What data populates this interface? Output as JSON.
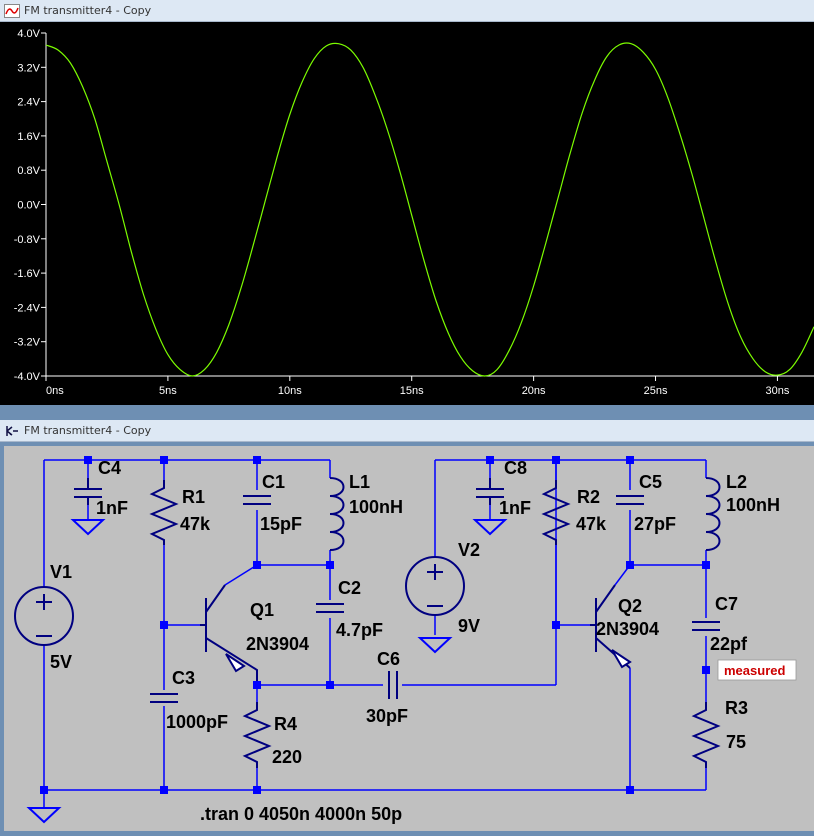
{
  "wave_window": {
    "title": "FM transmitter4 - Copy"
  },
  "schematic_window": {
    "title": "FM transmitter4 - Copy"
  },
  "chart_data": {
    "type": "line",
    "title": "",
    "xlabel": "",
    "ylabel": "",
    "x_ticks": [
      "0ns",
      "5ns",
      "10ns",
      "15ns",
      "20ns",
      "25ns",
      "30ns"
    ],
    "y_ticks": [
      "4.0V",
      "3.2V",
      "2.4V",
      "1.6V",
      "0.8V",
      "0.0V",
      "-0.8V",
      "-1.6V",
      "-2.4V",
      "-3.2V",
      "-4.0V"
    ],
    "xlim": [
      0,
      31.5
    ],
    "ylim": [
      -4.0,
      4.0
    ],
    "series": [
      {
        "color": "#7cfc00",
        "x": [
          0,
          0.5,
          1,
          1.5,
          2,
          2.5,
          3,
          3.5,
          4,
          4.5,
          5,
          5.5,
          6,
          6.5,
          7,
          7.5,
          8,
          8.5,
          9,
          9.5,
          10,
          10.5,
          11,
          11.5,
          12,
          12.5,
          13,
          13.5,
          14,
          14.5,
          15,
          15.5,
          16,
          16.5,
          17,
          17.5,
          18,
          18.5,
          19,
          19.5,
          20,
          20.5,
          21,
          21.5,
          22,
          22.5,
          23,
          23.5,
          24,
          24.5,
          25,
          25.5,
          26,
          26.5,
          27,
          27.5,
          28,
          28.5,
          29,
          29.5,
          30,
          30.5,
          31,
          31.5
        ],
        "y": [
          3.72,
          3.6,
          3.3,
          2.75,
          2.0,
          1.0,
          0.0,
          -1.1,
          -2.1,
          -2.9,
          -3.5,
          -3.85,
          -4.0,
          -3.85,
          -3.45,
          -2.8,
          -1.95,
          -0.95,
          0.1,
          1.15,
          2.1,
          2.85,
          3.4,
          3.7,
          3.75,
          3.6,
          3.2,
          2.55,
          1.75,
          0.8,
          -0.25,
          -1.3,
          -2.25,
          -3.0,
          -3.55,
          -3.88,
          -4.0,
          -3.85,
          -3.4,
          -2.75,
          -1.9,
          -0.9,
          0.15,
          1.2,
          2.15,
          2.9,
          3.45,
          3.72,
          3.75,
          3.55,
          3.15,
          2.5,
          1.65,
          0.7,
          -0.35,
          -1.4,
          -2.35,
          -3.1,
          -3.6,
          -3.9,
          -3.98,
          -3.85,
          -3.45,
          -2.85
        ]
      }
    ],
    "grid": false,
    "background": "#000000"
  },
  "schematic": {
    "labels": {
      "c4": "C4",
      "c4_val": "1nF",
      "r1": "R1",
      "r1_val": "47k",
      "c1": "C1",
      "c1_val": "15pF",
      "l1": "L1",
      "l1_val": "100nH",
      "c2": "C2",
      "c2_val": "4.7pF",
      "v1": "V1",
      "v1_val": "5V",
      "q1": "Q1",
      "q1_val": "2N3904",
      "c3": "C3",
      "c3_val": "1000pF",
      "r4": "R4",
      "r4_val": "220",
      "c6": "C6",
      "c6_val": "30pF",
      "v2": "V2",
      "v2_val": "9V",
      "c8": "C8",
      "c8_val": "1nF",
      "r2": "R2",
      "r2_val": "47k",
      "c5": "C5",
      "c5_val": "27pF",
      "l2": "L2",
      "l2_val": "100nH",
      "q2": "Q2",
      "q2_val": "2N3904",
      "c7": "C7",
      "c7_val": "22pf",
      "r3": "R3",
      "r3_val": "75",
      "measured": "measured",
      "directive": ".tran 0 4050n 4000n 50p"
    },
    "colors": {
      "wire": "#0000ff",
      "component": "#000080",
      "node": "#0000ff",
      "text": "#000000",
      "label": "#cc0000"
    }
  }
}
